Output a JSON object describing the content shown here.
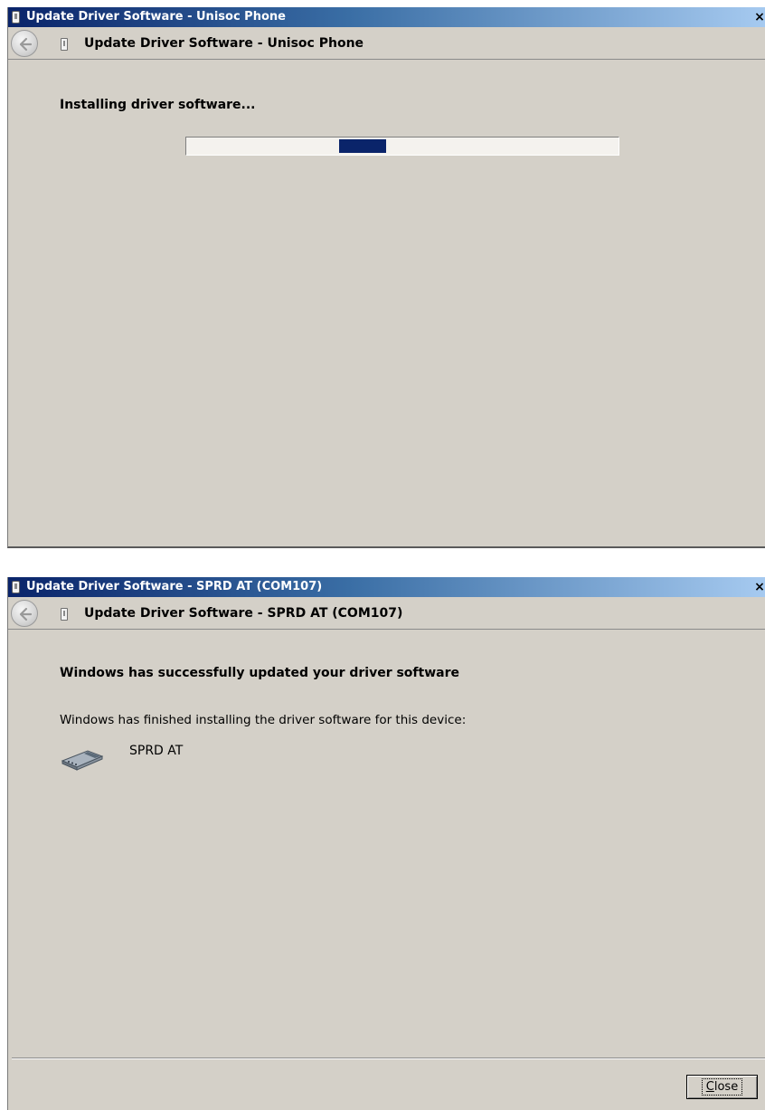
{
  "dialogs": [
    {
      "window_title": "Update Driver Software - Unisoc Phone",
      "close_glyph": "×",
      "nav_title": "Update Driver Software - Unisoc Phone",
      "heading": "Installing driver software...",
      "progress": {
        "style": "marquee",
        "chunk_start_fraction": 0.35,
        "chunk_width_fraction": 0.11
      }
    },
    {
      "window_title": "Update Driver Software - SPRD AT (COM107)",
      "close_glyph": "×",
      "nav_title": "Update Driver Software - SPRD AT (COM107)",
      "heading": "Windows has successfully updated your driver software",
      "message": "Windows has finished installing the driver software for this device:",
      "device_name": "SPRD AT",
      "device_icon": "modem-icon",
      "close_button": {
        "label_prefix": "",
        "mnemonic": "C",
        "label_rest": "lose"
      }
    }
  ],
  "colors": {
    "titlebar_start": "#0a246a",
    "titlebar_end": "#a6caf0",
    "dialog_bg": "#d4d0c8",
    "progress_fill": "#0a246a"
  }
}
